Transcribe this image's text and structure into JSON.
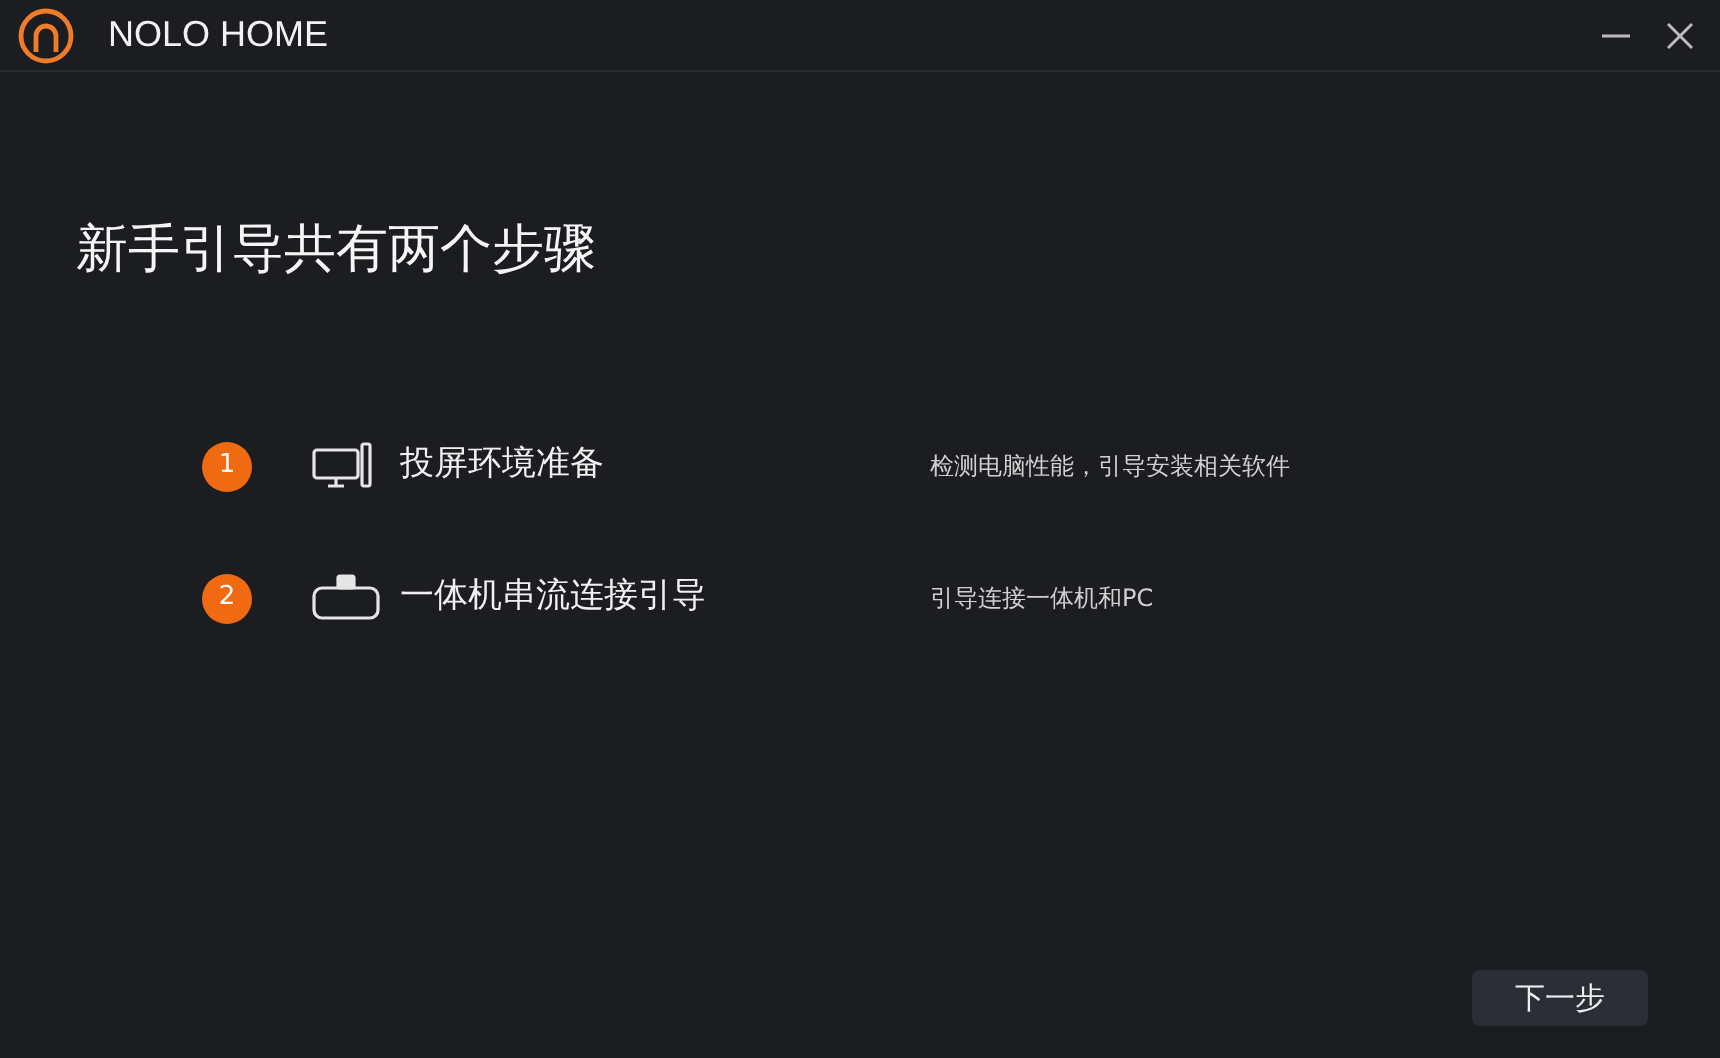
{
  "window": {
    "title": "NOLO HOME"
  },
  "heading": "新手引导共有两个步骤",
  "steps": [
    {
      "number": "1",
      "kind": "monitor",
      "label": "投屏环境准备",
      "description": "检测电脑性能，引导安装相关软件"
    },
    {
      "number": "2",
      "kind": "headset",
      "label": "一体机串流连接引导",
      "description": "引导连接一体机和PC"
    }
  ],
  "next_button": "下一步"
}
